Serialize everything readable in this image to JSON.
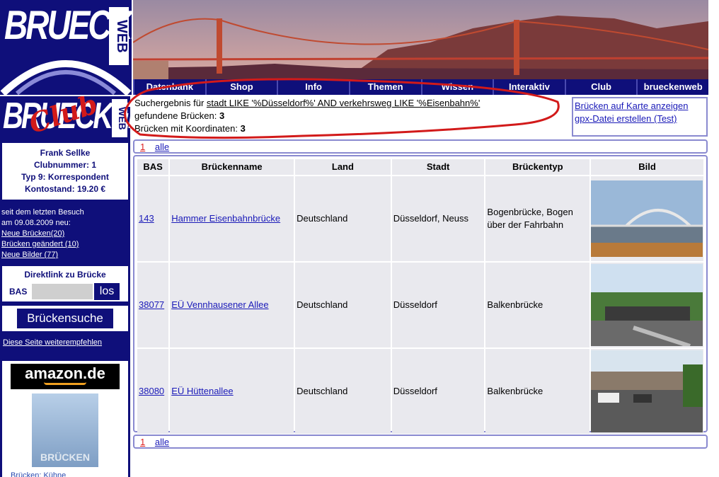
{
  "logo": {
    "word": "BRUECKEN",
    "suffix": "WEB"
  },
  "nav": {
    "tabs": [
      "Datenbank",
      "Shop",
      "Info",
      "Themen",
      "Wissen",
      "Interaktiv",
      "Club",
      "brueckenweb"
    ]
  },
  "club_logo": {
    "word": "BRUECKEN",
    "script": "Club",
    "suffix": "WEB"
  },
  "user": {
    "name": "Frank Sellke",
    "club_number": "Clubnummer: 1",
    "type": "Typ 9: Korrespondent",
    "balance": "Kontostand: 19.20 €"
  },
  "news": {
    "line1": "seit dem letzten Besuch",
    "line2": "am 09.08.2009 neu:",
    "links": [
      "Neue Brücken(20)",
      "Brücken geändert (10)",
      "Neue Bilder (77)"
    ]
  },
  "direct_link": {
    "title": "Direktlink zu Brücke",
    "label": "BAS",
    "value": "",
    "button": "los"
  },
  "search_button": "Brückensuche",
  "recommend": "Diese Seite weiterempfehlen",
  "amazon": {
    "brand": "amazon.de",
    "book_text": "BRÜCKEN",
    "caption": "Brücken: Kühne"
  },
  "query": {
    "prefix": "Suchergebnis für ",
    "expression": "stadt LIKE '%Düsseldorf%' AND verkehrsweg LIKE '%Eisenbahn%'",
    "found_label": "gefundene Brücken: ",
    "found_count": "3",
    "coords_label": "Brücken mit Koordinaten: ",
    "coords_count": "3"
  },
  "right_links": [
    "Brücken auf Karte anzeigen",
    "gpx-Datei erstellen (Test)"
  ],
  "pager": {
    "current": "1",
    "all": "alle"
  },
  "table": {
    "headers": [
      "BAS",
      "Brückenname",
      "Land",
      "Stadt",
      "Brückentyp",
      "Bild"
    ],
    "rows": [
      {
        "bas": "143",
        "name": "Hammer Eisenbahnbrücke",
        "land": "Deutschland",
        "stadt": "Düsseldorf, Neuss",
        "typ": "Bogenbrücke, Bogen über der Fahrbahn"
      },
      {
        "bas": "38077",
        "name": "EÜ Vennhausener Allee",
        "land": "Deutschland",
        "stadt": "Düsseldorf",
        "typ": "Balkenbrücke"
      },
      {
        "bas": "38080",
        "name": "EÜ Hüttenallee",
        "land": "Deutschland",
        "stadt": "Düsseldorf",
        "typ": "Balkenbrücke"
      }
    ]
  },
  "colors": {
    "navy": "#0f0f7a",
    "link": "#1a1ab8",
    "highlight": "#d21a1a",
    "cell": "#e9e9ee"
  }
}
